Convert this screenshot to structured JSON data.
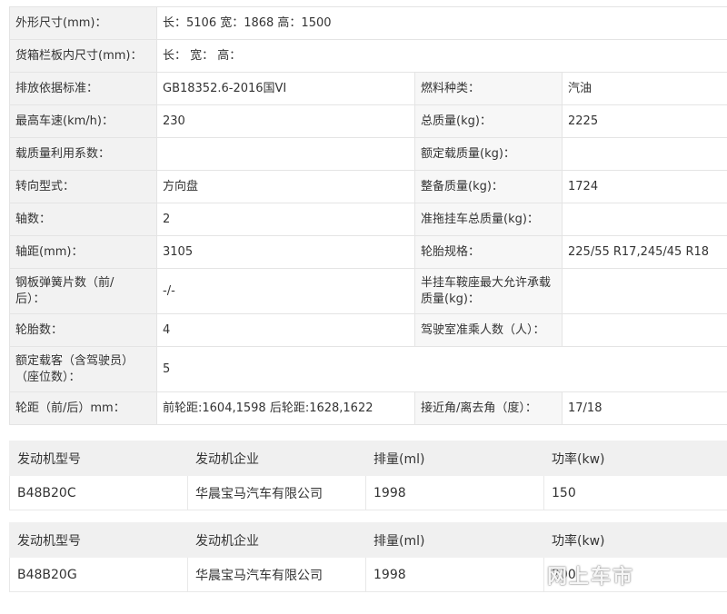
{
  "spec": {
    "r1": {
      "k": "外形尺寸(mm)：",
      "v": "长：5106 宽：1868 高：1500"
    },
    "r2": {
      "k": "货箱栏板内尺寸(mm)：",
      "v": "长： 宽： 高："
    },
    "r3": {
      "k1": "排放依据标准：",
      "v1": "GB18352.6-2016国VI",
      "k2": "燃料种类：",
      "v2": "汽油"
    },
    "r4": {
      "k1": "最高车速(km/h)：",
      "v1": "230",
      "k2": "总质量(kg)：",
      "v2": "2225"
    },
    "r5": {
      "k1": "载质量利用系数：",
      "v1": "",
      "k2": "额定载质量(kg)：",
      "v2": ""
    },
    "r6": {
      "k1": "转向型式：",
      "v1": "方向盘",
      "k2": "整备质量(kg)：",
      "v2": "1724"
    },
    "r7": {
      "k1": "轴数：",
      "v1": "2",
      "k2": "准拖挂车总质量(kg)：",
      "v2": ""
    },
    "r8": {
      "k1": "轴距(mm)：",
      "v1": "3105",
      "k2": "轮胎规格：",
      "v2": "225/55 R17,245/45 R18"
    },
    "r9": {
      "k1a": "钢板弹簧片数（前/",
      "k1b": "后）：",
      "v1": "-/-",
      "k2a": "半挂车鞍座最大允许承载",
      "k2b": "质量(kg)：",
      "v2": ""
    },
    "r10": {
      "k1": "轮胎数：",
      "v1": "4",
      "k2": "驾驶室准乘人数（人）：",
      "v2": ""
    },
    "r11": {
      "ka": "额定载客（含驾驶员）",
      "kb": "（座位数）：",
      "v": "5"
    },
    "r12": {
      "k1": "轮距（前/后）mm：",
      "v1": "前轮距:1604,1598 后轮距:1628,1622",
      "k2": "接近角/离去角（度）：",
      "v2": "17/18"
    }
  },
  "engine_headers": [
    "发动机型号",
    "发动机企业",
    "排量(ml)",
    "功率(kw)"
  ],
  "engines": [
    {
      "model": "B48B20C",
      "company": "华晨宝马汽车有限公司",
      "displacement": "1998",
      "power": "150"
    },
    {
      "model": "B48B20G",
      "company": "华晨宝马汽车有限公司",
      "displacement": "1998",
      "power": "200"
    }
  ],
  "watermark": "网上车市"
}
